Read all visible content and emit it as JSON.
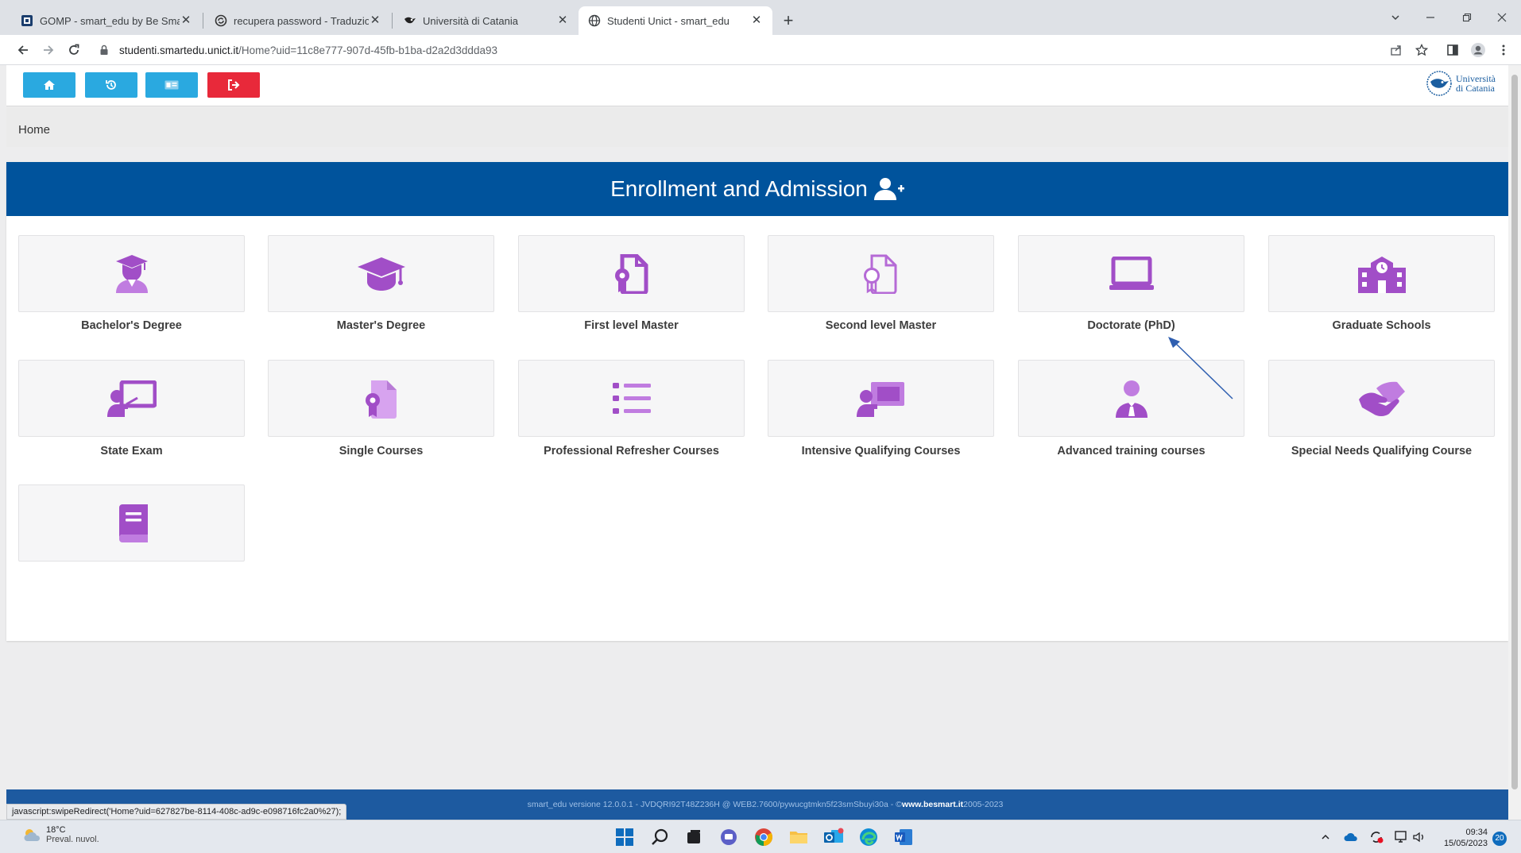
{
  "browser": {
    "tabs": [
      {
        "title": "GOMP - smart_edu by Be Smart",
        "icon": "gomp-favicon",
        "active": false
      },
      {
        "title": "recupera password - Traduzione",
        "icon": "reverso-favicon",
        "active": false
      },
      {
        "title": "Università di Catania",
        "icon": "unict-favicon",
        "active": false
      },
      {
        "title": "Studenti Unict - smart_edu",
        "icon": "globe-favicon",
        "active": true
      }
    ],
    "url_host": "studenti.smartedu.unict.it",
    "url_path": "/Home?uid=11c8e777-907d-45fb-b1ba-d2a2d3ddda93"
  },
  "header": {
    "buttons": [
      {
        "name": "home-button",
        "icon": "home-icon",
        "color": "#2aa9e0"
      },
      {
        "name": "history-button",
        "icon": "history-icon",
        "color": "#2aa9e0"
      },
      {
        "name": "card-button",
        "icon": "id-card-icon",
        "color": "#2aa9e0"
      },
      {
        "name": "logout-button",
        "icon": "sign-out-icon",
        "color": "#e8293a"
      }
    ],
    "logo_line1": "Università",
    "logo_line2": "di Catania"
  },
  "breadcrumb": "Home",
  "section": {
    "title": "Enrollment and Admission",
    "title_bg": "#00539c",
    "icon_color": "#a14ec7",
    "tiles": [
      {
        "label": "Bachelor's Degree",
        "icon": "graduate-user-icon"
      },
      {
        "label": "Master's Degree",
        "icon": "graduation-cap-icon"
      },
      {
        "label": "First level Master",
        "icon": "certificate-file-icon"
      },
      {
        "label": "Second level Master",
        "icon": "certificate-file-outline-icon"
      },
      {
        "label": "Doctorate (PhD)",
        "icon": "laptop-icon"
      },
      {
        "label": "Graduate Schools",
        "icon": "school-building-icon"
      },
      {
        "label": "State Exam",
        "icon": "teacher-board-icon"
      },
      {
        "label": "Single Courses",
        "icon": "award-file-icon"
      },
      {
        "label": "Professional Refresher Courses",
        "icon": "list-icon"
      },
      {
        "label": "Intensive Qualifying Courses",
        "icon": "presentation-user-icon"
      },
      {
        "label": "Advanced training courses",
        "icon": "businessman-icon"
      },
      {
        "label": "Special Needs Qualifying Course",
        "icon": "helping-hands-icon"
      },
      {
        "label": "",
        "icon": "book-icon"
      }
    ]
  },
  "footer": {
    "text": "smart_edu versione 12.0.0.1 - JVDQRI92T48Z236H @ WEB2.7600/pywucgtmkn5f23smSbuyi30a - © ",
    "link": "www.besmart.it",
    "years": " 2005-2023"
  },
  "status_url": "javascript:swipeRedirect('Home?uid=627827be-8114-408c-ad9c-e098716fc2a0%27);",
  "taskbar": {
    "temperature": "18°C",
    "weather": "Preval. nuvol.",
    "time": "09:34",
    "date": "15/05/2023",
    "notifications": "20"
  }
}
